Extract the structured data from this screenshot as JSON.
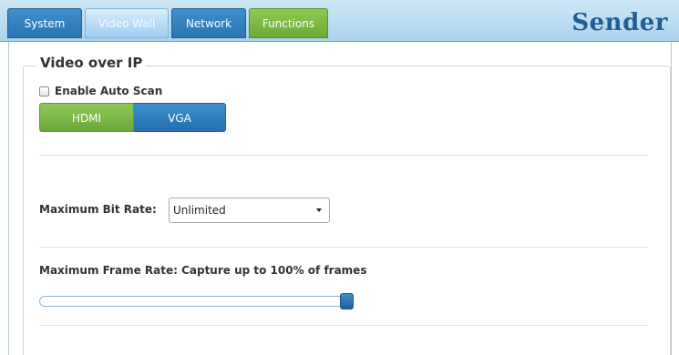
{
  "tabs": [
    {
      "label": "System"
    },
    {
      "label": "Video Wall"
    },
    {
      "label": "Network"
    },
    {
      "label": "Functions"
    }
  ],
  "brand": "Sender",
  "section": {
    "title": "Video over IP",
    "auto_scan_label": "Enable Auto Scan",
    "auto_scan_checked": false,
    "source_options": [
      "HDMI",
      "VGA"
    ],
    "source_selected": "HDMI",
    "bitrate_label": "Maximum Bit Rate:",
    "bitrate_value": "Unlimited",
    "framerate_label": "Maximum Frame Rate: Capture up to 100% of frames",
    "framerate_slider_fraction": 1.0
  },
  "colors": {
    "tab_blue": "#2a75b2",
    "tab_green": "#6daa35",
    "brand_blue": "#1f5f96"
  },
  "icons": [
    "dropdown-arrow-icon"
  ]
}
